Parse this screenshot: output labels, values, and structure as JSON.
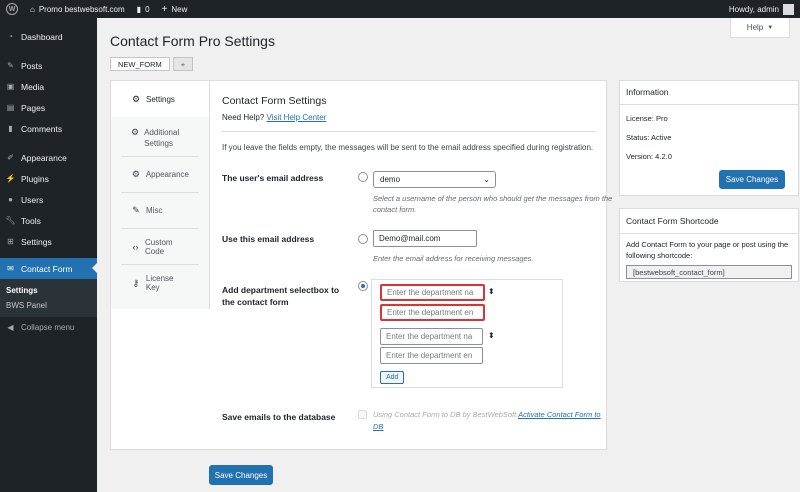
{
  "adminbar": {
    "site_name": "Promo bestwebsoft.com",
    "comments_count": "0",
    "new_label": "New",
    "howdy": "Howdy, admin"
  },
  "sidebar": {
    "items": [
      {
        "label": "Dashboard",
        "icon": "dashboard-icon"
      },
      {
        "label": "Posts",
        "icon": "pin-icon"
      },
      {
        "label": "Media",
        "icon": "media-icon"
      },
      {
        "label": "Pages",
        "icon": "page-icon"
      },
      {
        "label": "Comments",
        "icon": "comment-icon"
      },
      {
        "label": "Appearance",
        "icon": "brush-icon"
      },
      {
        "label": "Plugins",
        "icon": "plug-icon"
      },
      {
        "label": "Users",
        "icon": "user-icon"
      },
      {
        "label": "Tools",
        "icon": "wrench-icon"
      },
      {
        "label": "Settings",
        "icon": "sliders-icon"
      },
      {
        "label": "Contact Form",
        "icon": "mail-icon"
      }
    ],
    "submenu": [
      "Settings",
      "BWS Panel"
    ],
    "collapse": "Collapse menu"
  },
  "page": {
    "title": "Contact Form Pro Settings",
    "help": "Help",
    "tabs": [
      "NEW_FORM",
      "+"
    ]
  },
  "vtabs": [
    "Settings",
    "Additional Settings",
    "Appearance",
    "Misc",
    "Custom Code",
    "License Key"
  ],
  "form": {
    "title": "Contact Form Settings",
    "need_help": "Need Help?",
    "help_link": "Visit Help Center",
    "notice": "If you leave the fields empty, the messages will be sent to the email address specified during registration.",
    "user_email_label": "The user's email address",
    "user_select_value": "demo",
    "user_desc": "Select a username of the person who should get the messages from the contact form.",
    "use_email_label": "Use this email address",
    "email_value": "Demo@mail.com",
    "email_desc": "Enter the email address for receiving messages.",
    "dept_label": "Add department selectbox to the contact form",
    "dept_placeholder_1": "Enter the department na",
    "dept_placeholder_2": "Enter the department en",
    "dept_placeholder_3": "Enter the department na",
    "dept_placeholder_4": "Enter the department en",
    "add_label": "Add",
    "save_db_label": "Save emails to the database",
    "save_db_text": "Using Contact Form to DB by BestWebSoft",
    "save_db_link": "Activate Contact Form to DB",
    "save_button": "Save Changes"
  },
  "info": {
    "title": "Information",
    "license": "License: Pro",
    "status": "Status: Active",
    "version": "Version: 4.2.0",
    "save_button": "Save Changes"
  },
  "shortcode": {
    "title": "Contact Form Shortcode",
    "desc": "Add Contact Form to your page or post using the following shortcode:",
    "value": "[bestwebsoft_contact_form]"
  }
}
